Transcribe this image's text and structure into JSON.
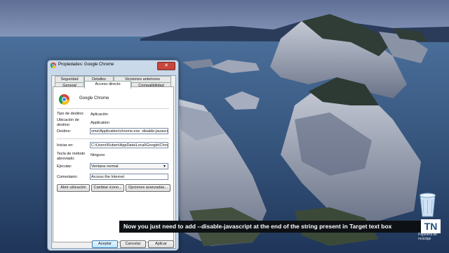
{
  "dialog": {
    "title": "Propiedades: Google Chrome",
    "close_symbol": "✕",
    "tabs_row1": [
      "Seguridad",
      "Detalles",
      "Versiones anteriores"
    ],
    "tabs_row2": [
      "General",
      "Acceso directo",
      "Compatibilidad"
    ],
    "active_tab": "Acceso directo",
    "app_name": "Google Chrome",
    "fields": {
      "target_type_label": "Tipo de destino:",
      "target_type_value": "Aplicación",
      "target_location_label": "Ubicación de destino:",
      "target_location_value": "Application",
      "target_label": "Destino:",
      "target_value": "ome\\Application\\chrome.exe -disable-javascript",
      "start_in_label": "Iniciar en:",
      "start_in_value": "C:\\Users\\Ruben\\AppData\\Local\\Google\\Chro",
      "shortcut_key_label": "Tecla de método abreviado:",
      "shortcut_key_value": "Ninguno",
      "run_label": "Ejecutar:",
      "run_value": "Ventana normal",
      "comment_label": "Comentario:",
      "comment_value": "Access the Internet"
    },
    "action_buttons": {
      "open_location": "Abrir ubicación",
      "change_icon": "Cambiar icono...",
      "advanced": "Opciones avanzadas..."
    },
    "footer_buttons": {
      "accept": "Aceptar",
      "cancel": "Cancelar",
      "apply": "Aplicar"
    }
  },
  "desktop": {
    "recycle_bin_label": "Papelera de reciclaje"
  },
  "overlay": {
    "caption": "Now you just need to add --disable-javascript at the end of the string present in Target text box",
    "logo": "TN"
  },
  "colors": {
    "dialog_frame": "#c9d9ea",
    "caption_bg": "#0d1014",
    "primary_button": "#bee6fd"
  }
}
